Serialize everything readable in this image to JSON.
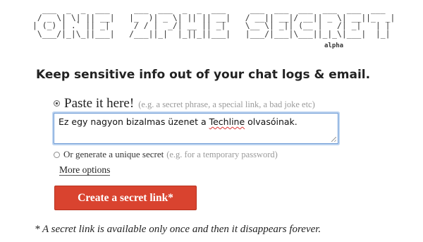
{
  "logo": {
    "ascii_art": "  ___  _  _  ___     ___  ___  _  _  ___     ___  ___  ___  ___  ___  ___  \n / _ \\| \\| || __|   |_  )| _ \\| || || __|   / __|| __|/ __|| _ \\| __||_  _| \n| (_) | .` || _|     / / |  _/| __ || _|    \\__ \\| _|| (__ |   /| _|   | |  \n \\___/|_|\\_||___|   /___||_|  |_||_||___|   |___/|___|\\___||_|_\\|___|  |_|  ",
    "badge": "alpha"
  },
  "headline": "Keep sensitive info out of your chat logs & email.",
  "paste_option": {
    "label": "Paste it here!",
    "hint": "(e.g. a secret phrase, a special link, a bad joke etc)",
    "selected": true
  },
  "secret_input": {
    "value_before": "Ez egy nagyon bizalmas üzenet a ",
    "value_flagged": "Techline",
    "value_after": " olvasóinak."
  },
  "generate_option": {
    "label": "Or generate a unique secret",
    "hint": "(e.g. for a temporary password)",
    "selected": false
  },
  "more_options_link": "More options",
  "create_button": "Create a secret link*",
  "footnote": "* A secret link is available only once and then it disappears forever.",
  "colors": {
    "button_bg": "#d9432f",
    "input_focus": "#6e9bd5",
    "hint_text": "#9a9a9a"
  }
}
